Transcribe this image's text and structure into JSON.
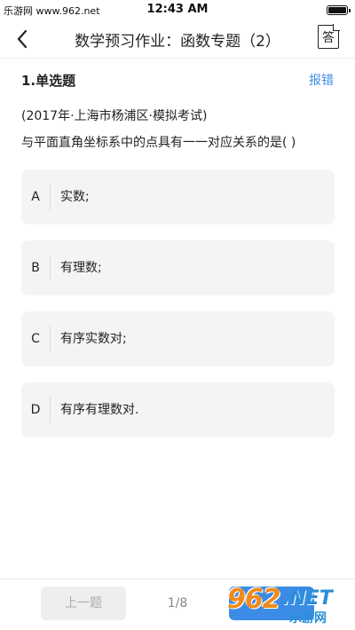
{
  "status_bar": {
    "watermark": "乐游网 www.962.net",
    "time": "12:43 AM"
  },
  "nav": {
    "title": "数学预习作业：函数专题（2）",
    "answer_label": "答"
  },
  "question": {
    "type_label": "1.单选题",
    "report_label": "报错",
    "source": "(2017年·上海市杨浦区·模拟考试)",
    "stem": "与平面直角坐标系中的点具有一一对应关系的是( )",
    "options": [
      {
        "letter": "A",
        "text": "实数;"
      },
      {
        "letter": "B",
        "text": "有理数;"
      },
      {
        "letter": "C",
        "text": "有序实数对;"
      },
      {
        "letter": "D",
        "text": "有序有理数对."
      }
    ]
  },
  "bottom": {
    "prev_label": "上一题",
    "page": "1/8"
  },
  "logo": {
    "num": "962",
    "net": ".NET",
    "sub": "乐游网"
  },
  "icons": {
    "back": "chevron-left-icon",
    "answer": "answer-sheet-icon",
    "battery": "battery-icon"
  },
  "colors": {
    "accent": "#3c8ce6",
    "option_bg": "#f4f4f4",
    "logo_orange": "#f08a1c",
    "logo_blue": "#2a8fd8"
  }
}
